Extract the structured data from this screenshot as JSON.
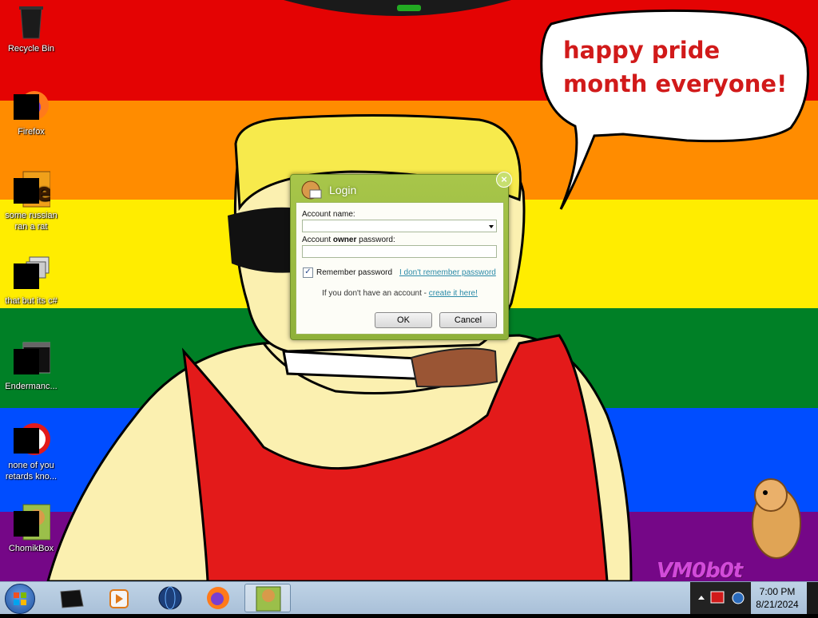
{
  "desktop": {
    "bubble_text": "happy pride month everyone!",
    "signature": "VM0b0t",
    "icons": [
      {
        "label": "Recycle Bin",
        "icon": "recycle-bin-icon"
      },
      {
        "label": "Firefox",
        "icon": "firefox-icon"
      },
      {
        "label": "some russian ran a rat",
        "icon": "app-e-icon"
      },
      {
        "label": "that but its c#",
        "icon": "windows-stack-icon"
      },
      {
        "label": "Endermanc...",
        "icon": "console-icon"
      },
      {
        "label": "none of you retards kno...",
        "icon": "red-circle-icon"
      },
      {
        "label": "ChomikBox",
        "icon": "hamster-box-icon"
      }
    ]
  },
  "dialog": {
    "title": "Login",
    "close_glyph": "×",
    "account_name_label": "Account name:",
    "account_name_value": "",
    "password_label_pre": "Account ",
    "password_label_bold": "owner",
    "password_label_post": " password:",
    "password_value": "",
    "remember_label": "Remember password",
    "remember_checked": true,
    "check_glyph": "✓",
    "forgot_link": "I don't remember password",
    "no_account_text": "If you don't have an account - ",
    "create_link": "create it here!",
    "ok_label": "OK",
    "cancel_label": "Cancel"
  },
  "taskbar": {
    "items": [
      "media-center-icon",
      "media-player-icon",
      "globe-icon",
      "firefox-icon",
      "chomikbox-icon"
    ],
    "active_item": "chomikbox-icon",
    "clock_time": "7:00 PM",
    "clock_date": "8/21/2024"
  },
  "colors": {
    "dialog_green": "#98b83f",
    "link": "#2a8aa8",
    "bubble_text": "#d11a1a"
  }
}
